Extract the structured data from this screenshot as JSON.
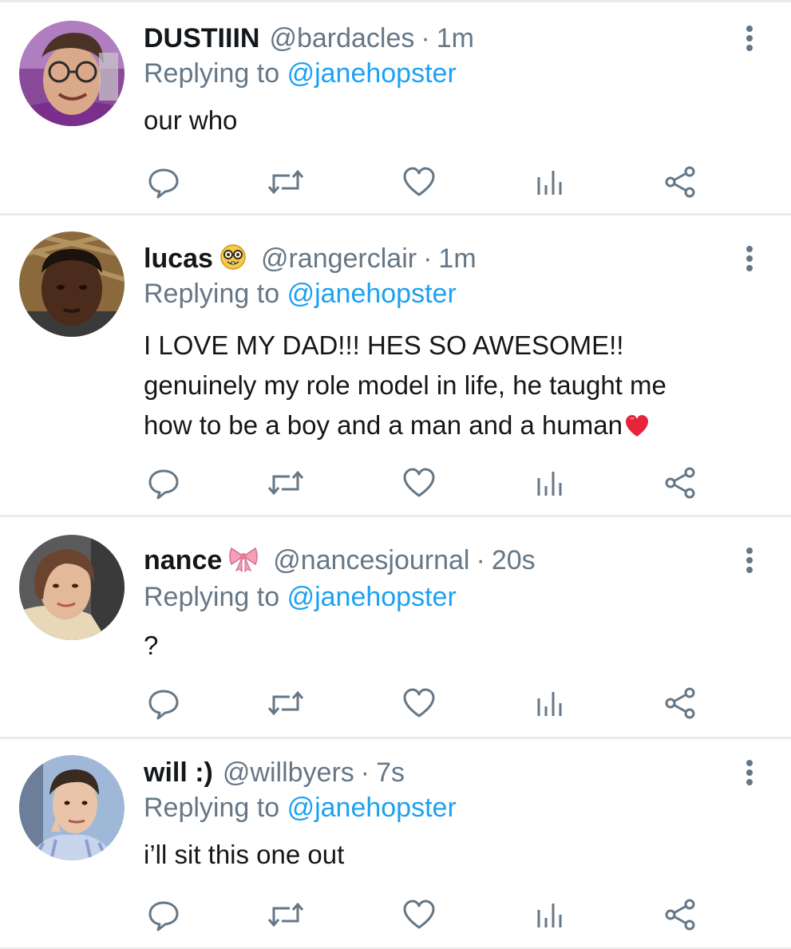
{
  "colors": {
    "text": "#14171a",
    "secondary": "#657786",
    "link": "#1da1f2",
    "divider": "#e6ecf0",
    "icon": "#657786"
  },
  "tweets": [
    {
      "name": "DUSTIIIN",
      "name_emoji": "",
      "handle": "@bardacles",
      "time": "1m",
      "replying_prefix": "Replying to",
      "replying_handle": "@janehopster",
      "lines": [
        "our who"
      ],
      "line_end_emoji": ""
    },
    {
      "name": "lucas",
      "name_emoji": "nerd-face-emoji",
      "handle": "@rangerclair",
      "time": "1m",
      "replying_prefix": "Replying to",
      "replying_handle": "@janehopster",
      "lines": [
        "I LOVE MY DAD!!! HES SO AWESOME!!",
        "genuinely my role model in life, he taught me",
        "how to be a boy and a man and a human"
      ],
      "line_end_emoji": "red-heart-emoji"
    },
    {
      "name": "nance",
      "name_emoji": "ribbon-emoji",
      "handle": "@nancesjournal",
      "time": "20s",
      "replying_prefix": "Replying to",
      "replying_handle": "@janehopster",
      "lines": [
        "?"
      ],
      "line_end_emoji": ""
    },
    {
      "name": "will :)",
      "name_emoji": "",
      "handle": "@willbyers",
      "time": "7s",
      "replying_prefix": "Replying to",
      "replying_handle": "@janehopster",
      "lines": [
        "i’ll sit this one out"
      ],
      "line_end_emoji": ""
    }
  ],
  "separator": "·"
}
